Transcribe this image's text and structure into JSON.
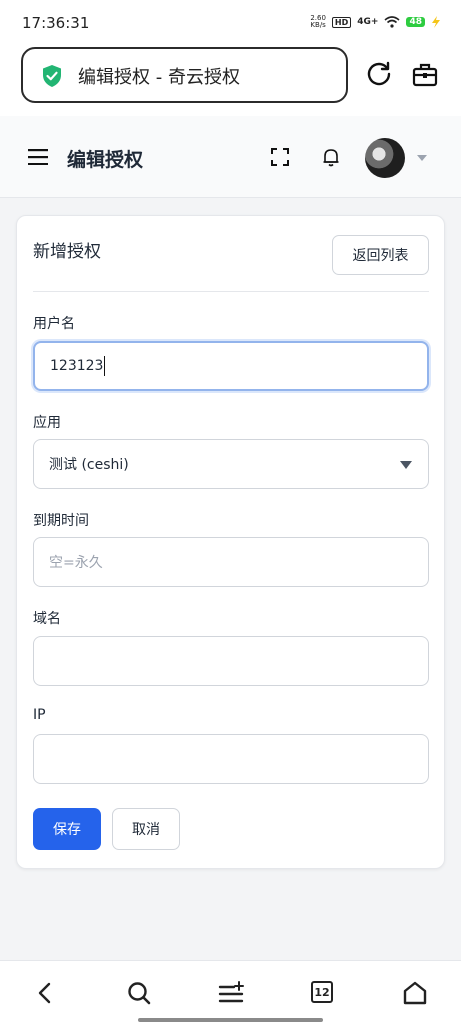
{
  "status_bar": {
    "time": "17:36:31",
    "net_speed": "2.60",
    "net_unit": "KB/s",
    "hd": "HD",
    "signal": "4G+",
    "battery": "48"
  },
  "browser": {
    "url_text": "编辑授权 - 奇云授权"
  },
  "header": {
    "title": "编辑授权"
  },
  "card": {
    "title": "新增授权",
    "back_label": "返回列表"
  },
  "form": {
    "username": {
      "label": "用户名",
      "value": "123123"
    },
    "app": {
      "label": "应用",
      "value": "测试 (ceshi)"
    },
    "expire": {
      "label": "到期时间",
      "placeholder": "空=永久"
    },
    "domain": {
      "label": "域名",
      "value": ""
    },
    "ip": {
      "label": "IP",
      "value": ""
    }
  },
  "actions": {
    "save": "保存",
    "cancel": "取消"
  },
  "bottom_nav": {
    "tab_count": "12"
  },
  "colors": {
    "primary": "#2563eb",
    "focus_border": "#93b4ec",
    "shield": "#22b573"
  }
}
